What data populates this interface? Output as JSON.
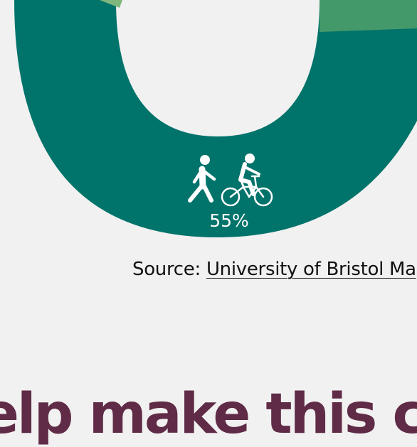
{
  "chart_data": {
    "type": "pie",
    "style": "donut",
    "slices": [
      {
        "label": "walking-cycling",
        "value": 55,
        "label_text": "55%",
        "color": "#00736a"
      },
      {
        "label": "upper-right-segment",
        "color": "#44996a"
      },
      {
        "label": "upper-left-segment",
        "color": "#7fb77e"
      }
    ],
    "icons": [
      "walking-person-icon",
      "bicycle-icon"
    ]
  },
  "source": {
    "prefix": "Source: ",
    "link_text": "University of Bristol Ma"
  },
  "cta": {
    "heading": "elp make this chan"
  },
  "colors": {
    "background": "#f1f1f1",
    "heading": "#5f2b46"
  }
}
